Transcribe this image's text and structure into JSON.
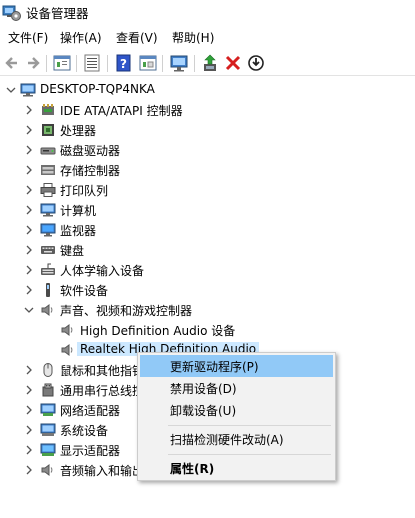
{
  "window": {
    "title": "设备管理器"
  },
  "menubar": [
    "文件(F)",
    "操作(A)",
    "查看(V)",
    "帮助(H)"
  ],
  "toolbar": [
    {
      "name": "back-arrow-icon"
    },
    {
      "name": "forward-arrow-icon"
    },
    {
      "name": "properties-sheet-icon"
    },
    {
      "name": "list-view-icon"
    },
    {
      "name": "help-icon"
    },
    {
      "name": "action-pane-icon"
    },
    {
      "name": "monitor-scan-icon"
    },
    {
      "name": "update-driver-icon"
    },
    {
      "name": "uninstall-x-icon"
    },
    {
      "name": "disable-device-icon"
    }
  ],
  "tree": {
    "root": "DESKTOP-TQP4NKA",
    "categories": [
      {
        "label": "IDE ATA/ATAPI 控制器",
        "icon": "ide-controller-icon"
      },
      {
        "label": "处理器",
        "icon": "processor-icon"
      },
      {
        "label": "磁盘驱动器",
        "icon": "disk-drive-icon"
      },
      {
        "label": "存储控制器",
        "icon": "storage-controller-icon"
      },
      {
        "label": "打印队列",
        "icon": "printer-icon"
      },
      {
        "label": "计算机",
        "icon": "computer-icon"
      },
      {
        "label": "监视器",
        "icon": "monitor-icon"
      },
      {
        "label": "键盘",
        "icon": "keyboard-icon"
      },
      {
        "label": "人体学输入设备",
        "icon": "hid-icon"
      },
      {
        "label": "软件设备",
        "icon": "software-device-icon"
      },
      {
        "label": "声音、视频和游戏控制器",
        "icon": "speaker-icon",
        "expanded": true
      },
      {
        "label": "High Definition Audio 设备",
        "icon": "speaker-icon",
        "child": true
      },
      {
        "label": "Realtek High Definition Audio",
        "icon": "speaker-icon",
        "child": true,
        "selected": true
      },
      {
        "label": "鼠标和其他指针设备",
        "icon": "mouse-icon"
      },
      {
        "label": "通用串行总线控制器",
        "icon": "usb-icon"
      },
      {
        "label": "网络适配器",
        "icon": "network-adapter-icon"
      },
      {
        "label": "系统设备",
        "icon": "system-device-icon"
      },
      {
        "label": "显示适配器",
        "icon": "display-adapter-icon"
      },
      {
        "label": "音频输入和输出",
        "icon": "speaker-icon"
      }
    ]
  },
  "context_menu": {
    "items": [
      {
        "label": "更新驱动程序(P)",
        "highlighted": true
      },
      {
        "label": "禁用设备(D)"
      },
      {
        "label": "卸载设备(U)"
      },
      {
        "separator": true
      },
      {
        "label": "扫描检测硬件改动(A)"
      },
      {
        "separator": true
      },
      {
        "label": "属性(R)",
        "bold": true
      }
    ]
  },
  "colors": {
    "selection": "#cce8ff",
    "menu_highlight": "#91c9f7",
    "menu_bg": "#f2f2f2"
  }
}
